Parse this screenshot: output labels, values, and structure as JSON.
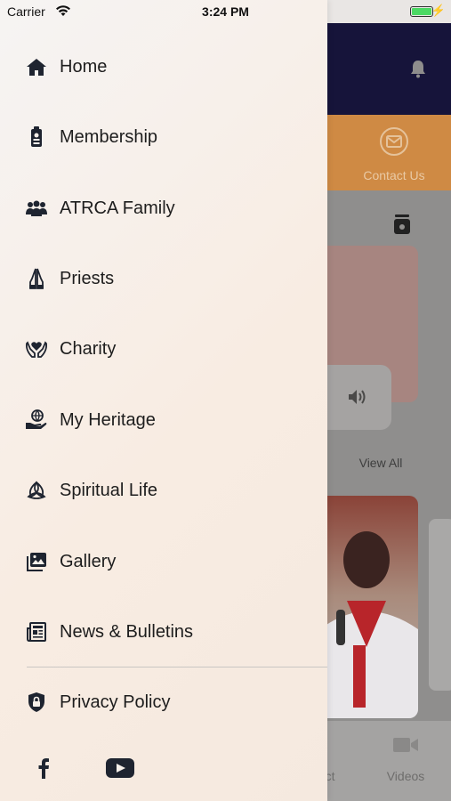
{
  "status_bar": {
    "carrier": "Carrier",
    "time": "3:24 PM",
    "battery_color": "#4cd964"
  },
  "background_app": {
    "header_color": "#16143a",
    "accent_color": "#cf8a44",
    "contact_label": "Contact Us",
    "view_all_label": "View All",
    "tab_connect_label": "nect",
    "tab_videos_label": "Videos",
    "icons": [
      "bell-icon",
      "mail-icon",
      "jar-icon",
      "speaker-icon",
      "video-camera-icon"
    ]
  },
  "drawer": {
    "menu": [
      {
        "label": "Home",
        "icon": "home-icon"
      },
      {
        "label": "Membership",
        "icon": "id-badge-icon"
      },
      {
        "label": "ATRCA Family",
        "icon": "people-icon"
      },
      {
        "label": "Priests",
        "icon": "praying-hands-icon"
      },
      {
        "label": "Charity",
        "icon": "heart-hands-icon"
      },
      {
        "label": "My Heritage",
        "icon": "globe-hand-icon"
      },
      {
        "label": "Spiritual Life",
        "icon": "trinity-knot-icon"
      },
      {
        "label": "Gallery",
        "icon": "gallery-icon"
      },
      {
        "label": "News & Bulletins",
        "icon": "newspaper-icon"
      },
      {
        "label": "Privacy Policy",
        "icon": "shield-lock-icon"
      }
    ],
    "social": [
      "facebook-icon",
      "youtube-icon"
    ]
  }
}
